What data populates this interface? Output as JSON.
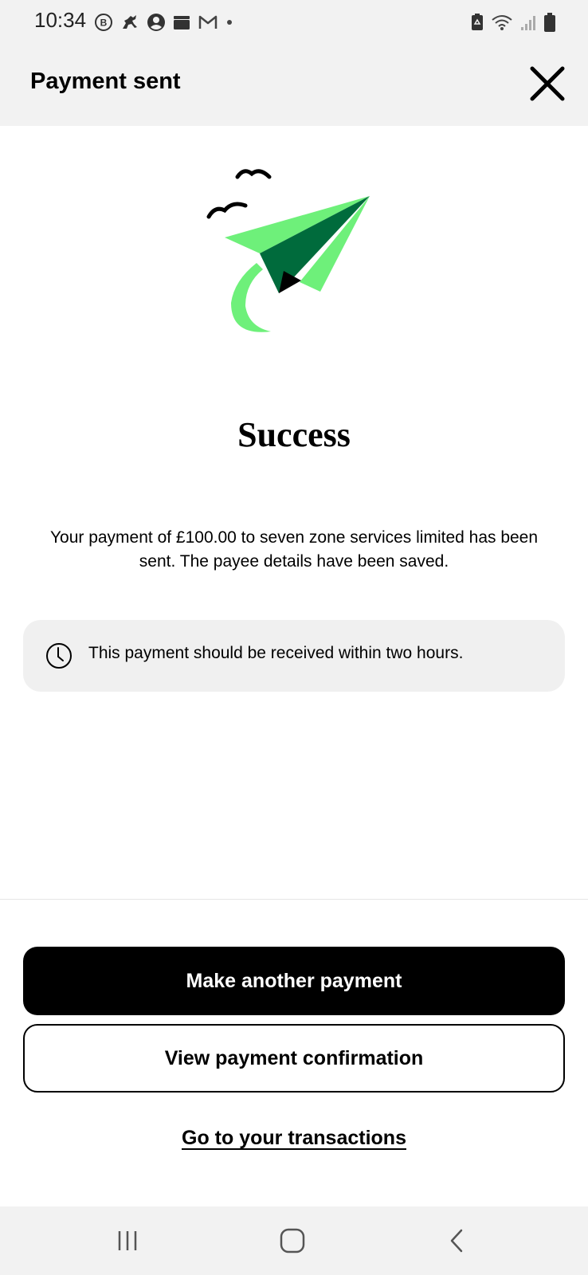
{
  "status_bar": {
    "time": "10:34",
    "left_icons": [
      "b-circle-icon",
      "horse-icon",
      "account-circle-icon",
      "wallet-icon",
      "gmail-icon",
      "dot-icon"
    ],
    "right_icons": [
      "battery-saver-icon",
      "wifi-icon",
      "signal-icon",
      "battery-icon"
    ]
  },
  "header": {
    "title": "Payment sent",
    "close_icon": "close-icon"
  },
  "illustration": {
    "icon": "paper-plane-icon",
    "colors": {
      "plane_light": "#6ef07a",
      "plane_dark": "#006b3c",
      "plane_black": "#000000"
    }
  },
  "main": {
    "title": "Success",
    "message": "Your payment of £100.00 to seven zone services limited has been sent. The payee details have been saved.",
    "info": {
      "icon": "clock-icon",
      "text": "This payment should be received within two hours."
    }
  },
  "actions": {
    "primary_label": "Make another payment",
    "secondary_label": "View payment confirmation",
    "link_label": "Go to your transactions"
  },
  "nav_bar": {
    "items": [
      "recents-icon",
      "home-icon",
      "back-icon"
    ]
  }
}
